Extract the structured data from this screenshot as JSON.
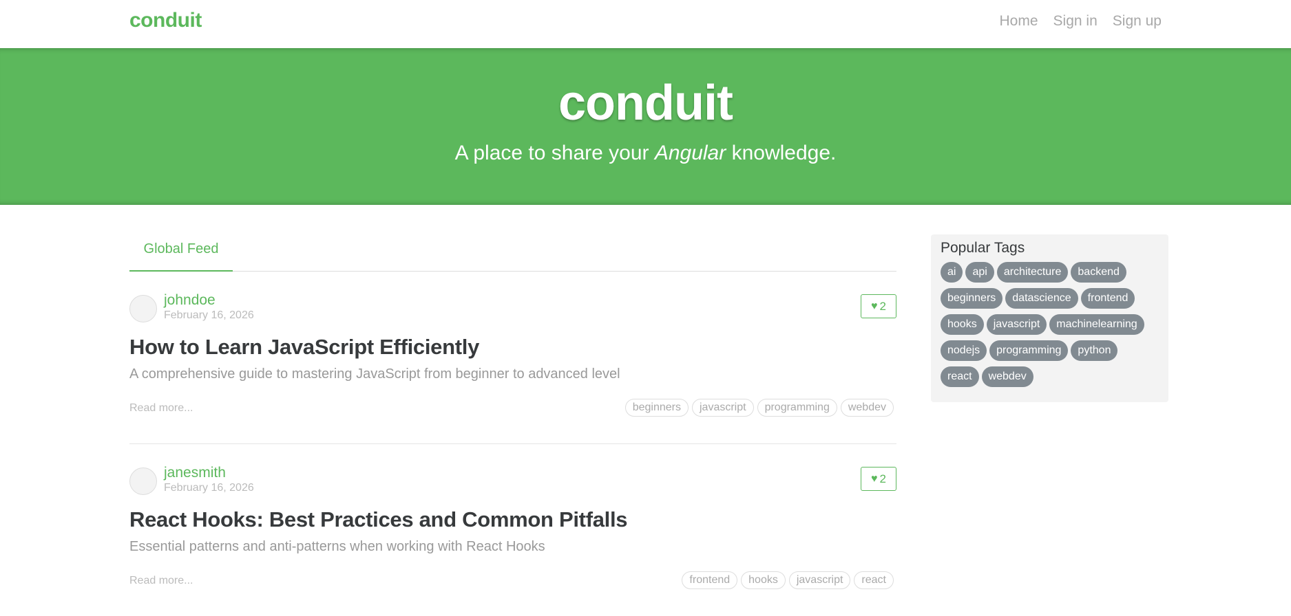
{
  "nav": {
    "brand": "conduit",
    "links": [
      "Home",
      "Sign in",
      "Sign up"
    ]
  },
  "banner": {
    "title": "conduit",
    "tagline_before": "A place to share your ",
    "tagline_em": "Angular",
    "tagline_after": " knowledge."
  },
  "feed": {
    "tab": "Global Feed",
    "articles": [
      {
        "author": "johndoe",
        "date": "February 16, 2026",
        "likes": "2",
        "title": "How to Learn JavaScript Efficiently",
        "description": "A comprehensive guide to mastering JavaScript from beginner to advanced level",
        "read_more": "Read more...",
        "tags": [
          "beginners",
          "javascript",
          "programming",
          "webdev"
        ]
      },
      {
        "author": "janesmith",
        "date": "February 16, 2026",
        "likes": "2",
        "title": "React Hooks: Best Practices and Common Pitfalls",
        "description": "Essential patterns and anti-patterns when working with React Hooks",
        "read_more": "Read more...",
        "tags": [
          "frontend",
          "hooks",
          "javascript",
          "react"
        ]
      }
    ]
  },
  "sidebar": {
    "title": "Popular Tags",
    "tags": [
      "ai",
      "api",
      "architecture",
      "backend",
      "beginners",
      "datascience",
      "frontend",
      "hooks",
      "javascript",
      "machinelearning",
      "nodejs",
      "programming",
      "python",
      "react",
      "webdev"
    ]
  },
  "colors": {
    "brand_green": "#5cb85c",
    "tag_gray": "#818a91"
  },
  "icons": {
    "like": "heart-icon"
  }
}
